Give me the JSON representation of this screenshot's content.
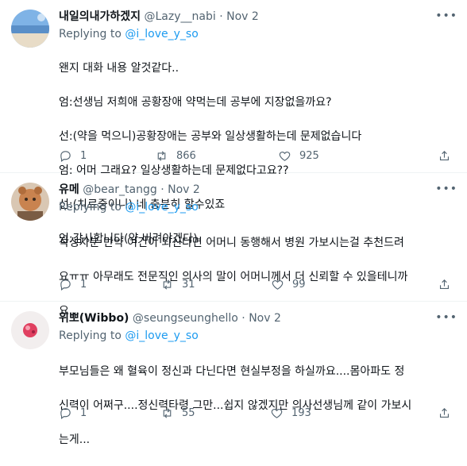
{
  "tweets": [
    {
      "name": "내일의내가하겠지",
      "handle": "@Lazy__nabi",
      "dot": "·",
      "date": "Nov 2",
      "replying_prefix": "Replying to",
      "replying_to": "@i_love_y_so",
      "lines": [
        "왠지 대화 내용 알것같다..",
        "엄:선생님 저희애 공황장애 약먹는데 공부에 지장없을까요?",
        "선:(약을 먹으니)공황장애는 공부와 일상생활하는데 문제없습니다",
        "엄: 어머 그래요? 일상생활하는데 문제없다고요??",
        "선:(치료중이니) 네 충분히 할수있죠",
        "엄:감사합니다(약 버려야겠다)"
      ],
      "replies": "1",
      "retweets": "866",
      "likes": "925"
    },
    {
      "name": "유메",
      "handle": "@bear_tangg",
      "dot": "·",
      "date": "Nov 2",
      "replying_prefix": "Replying to",
      "replying_to": "@i_love_y_so",
      "lines": [
        "작성자분 만약 여건이 되신다면 어머니 동행해서 병원 가보시는걸 추천드려",
        "요ㅠㅠ 아무래도 전문직인 의사의 말이 어머니께서 더 신뢰할 수 있을테니까",
        "요..."
      ],
      "replies": "1",
      "retweets": "31",
      "likes": "99"
    },
    {
      "name": "위뽀(Wibbo)",
      "handle": "@seungseunghello",
      "dot": "·",
      "date": "Nov 2",
      "replying_prefix": "Replying to",
      "replying_to": "@i_love_y_so",
      "lines": [
        "부모님들은 왜 혈육이 정신과 다닌다면 현실부정을 하실까요....몸아파도 정",
        "신력이 어쩌구....정신력타령 그만...쉽지 않겠지만 의사선생님께 같이 가보시",
        "는게..."
      ],
      "replies": "1",
      "retweets": "55",
      "likes": "193"
    }
  ],
  "icons": {
    "more": "more-icon",
    "reply": "reply-icon",
    "retweet": "retweet-icon",
    "like": "heart-icon",
    "share": "share-icon"
  }
}
